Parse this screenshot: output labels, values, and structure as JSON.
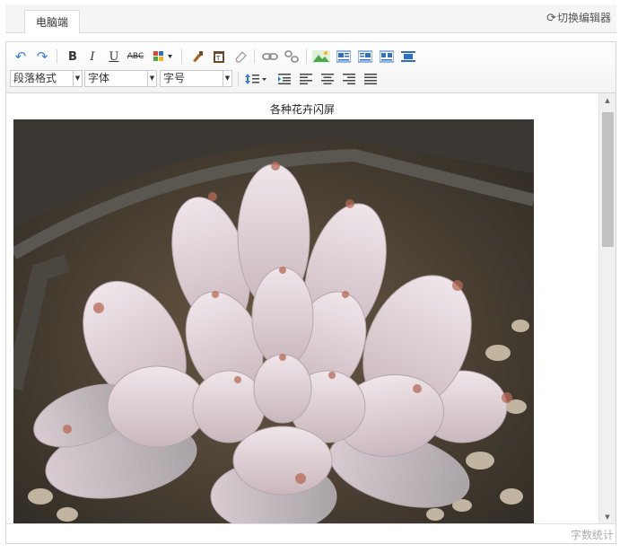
{
  "tabs": {
    "active": "电脑端",
    "switch_label": "切换编辑器",
    "switch_icon": "refresh-icon"
  },
  "toolbar": {
    "row1": [
      {
        "name": "undo-icon",
        "glyph": "↶",
        "color": "#3a7fd5"
      },
      {
        "name": "redo-icon",
        "glyph": "↷",
        "color": "#3a7fd5"
      },
      {
        "name": "bold-button",
        "glyph": "B",
        "color": "#222"
      },
      {
        "name": "italic-button",
        "glyph": "I",
        "color": "#222"
      },
      {
        "name": "underline-button",
        "glyph": "U",
        "color": "#222"
      },
      {
        "name": "strikethrough-button",
        "glyph": "ABC",
        "color": "#444"
      },
      {
        "name": "font-color-icon",
        "glyph": "▦",
        "color": "#e0452b"
      },
      {
        "name": "format-painter-icon",
        "glyph": "✎",
        "color": "#a8642a"
      },
      {
        "name": "paste-plain-icon",
        "glyph": "▤",
        "color": "#6b4b2a"
      },
      {
        "name": "clear-format-icon",
        "glyph": "⌫",
        "color": "#888"
      },
      {
        "name": "link-icon",
        "glyph": "⛓",
        "color": "#777"
      },
      {
        "name": "unlink-icon",
        "glyph": "⚭",
        "color": "#777"
      },
      {
        "name": "image-icon",
        "glyph": "▲",
        "color": "#4aa84a"
      },
      {
        "name": "image-left-icon",
        "glyph": "▤",
        "color": "#2f6fc0"
      },
      {
        "name": "image-right-icon",
        "glyph": "▤",
        "color": "#2f6fc0"
      },
      {
        "name": "image-center-icon",
        "glyph": "▤",
        "color": "#2f6fc0"
      },
      {
        "name": "image-block-icon",
        "glyph": "▬",
        "color": "#2f6fc0"
      }
    ],
    "selects": {
      "paragraph": "段落格式",
      "font": "字体",
      "size": "字号"
    },
    "row2": [
      {
        "name": "line-height-icon",
        "glyph": "↕≡",
        "color": "#3a7fd5"
      },
      {
        "name": "indent-icon",
        "glyph": "⇥",
        "color": "#444"
      },
      {
        "name": "align-left-icon",
        "glyph": "≡",
        "color": "#444"
      },
      {
        "name": "align-center-icon",
        "glyph": "≡",
        "color": "#444"
      },
      {
        "name": "align-right-icon",
        "glyph": "≡",
        "color": "#444"
      },
      {
        "name": "align-justify-icon",
        "glyph": "≣",
        "color": "#444"
      }
    ]
  },
  "content": {
    "caption": "各种花卉闪屏"
  },
  "status": {
    "word_count": "字数统计"
  }
}
